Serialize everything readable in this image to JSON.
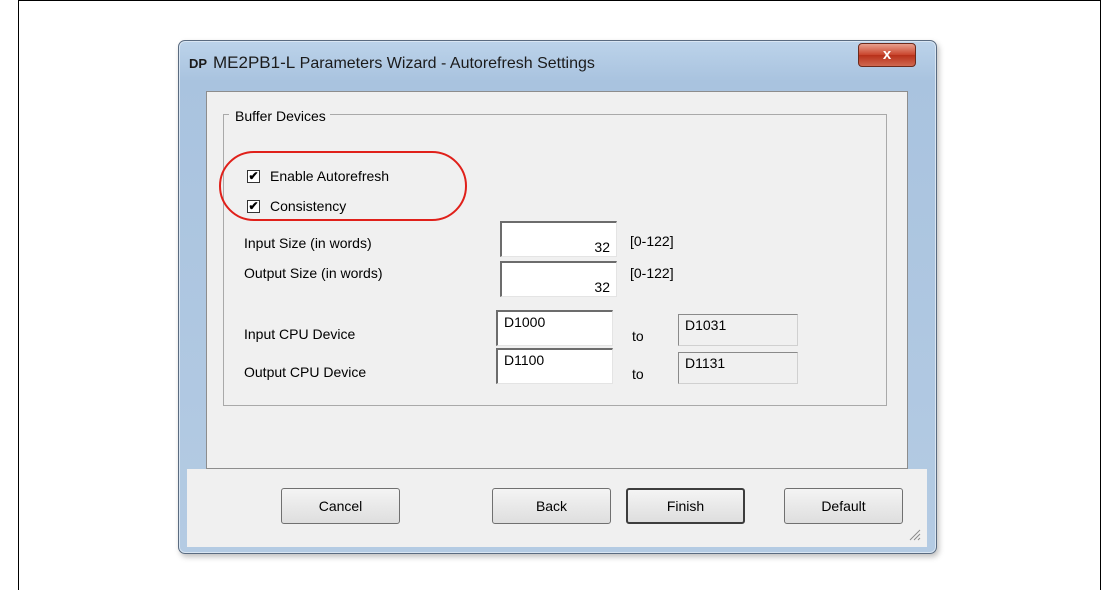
{
  "window": {
    "icon_text": "DP",
    "title_model": "ME2PB1-L",
    "title_rest": " Parameters Wizard - Autorefresh Settings",
    "close_label": "x"
  },
  "group": {
    "label": "Buffer Devices",
    "enable_autorefresh": {
      "label": "Enable Autorefresh",
      "checked": true,
      "mark": "✔"
    },
    "consistency": {
      "label": "Consistency",
      "checked": true,
      "mark": "✔"
    }
  },
  "sizes": {
    "input_label": "Input Size (in words)",
    "input_value": "32",
    "input_range": "[0-122]",
    "output_label": "Output Size (in words)",
    "output_value": "32",
    "output_range": "[0-122]"
  },
  "devices": {
    "input_label": "Input CPU Device",
    "input_from": "D1000",
    "input_to_label": "to",
    "input_to": "D1031",
    "output_label": "Output CPU Device",
    "output_from": "D1100",
    "output_to_label": "to",
    "output_to": "D1131"
  },
  "buttons": {
    "cancel": "Cancel",
    "back": "Back",
    "finish": "Finish",
    "default": "Default"
  },
  "colors": {
    "highlight_oval": "#e0201a",
    "close_button": "#c9442c"
  }
}
